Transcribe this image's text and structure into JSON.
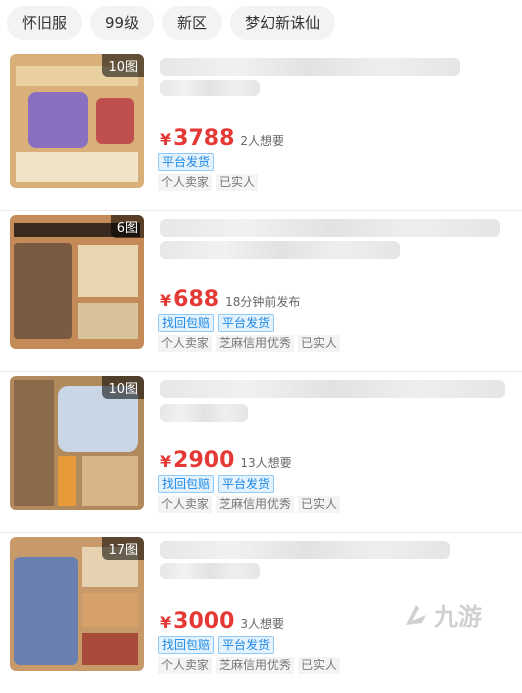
{
  "filters": [
    "怀旧服",
    "99级",
    "新区",
    "梦幻新诛仙"
  ],
  "listings": [
    {
      "image_count": "10图",
      "price": "3788",
      "meta": "2人想要",
      "badges": [
        "平台发货"
      ],
      "sellers": [
        "个人卖家",
        "已实人"
      ]
    },
    {
      "image_count": "6图",
      "price": "688",
      "meta": "18分钟前发布",
      "badges": [
        "找回包赔",
        "平台发货"
      ],
      "sellers": [
        "个人卖家",
        "芝麻信用优秀",
        "已实人"
      ]
    },
    {
      "image_count": "10图",
      "price": "2900",
      "meta": "13人想要",
      "badges": [
        "找回包赔",
        "平台发货"
      ],
      "sellers": [
        "个人卖家",
        "芝麻信用优秀",
        "已实人"
      ]
    },
    {
      "image_count": "17图",
      "price": "3000",
      "meta": "3人想要",
      "badges": [
        "找回包赔",
        "平台发货"
      ],
      "sellers": [
        "个人卖家",
        "芝麻信用优秀",
        "已实人"
      ]
    }
  ],
  "currency_symbol": "¥",
  "watermark": "九游",
  "colors": {
    "price": "#e53935",
    "badge": "#1e88e5"
  }
}
